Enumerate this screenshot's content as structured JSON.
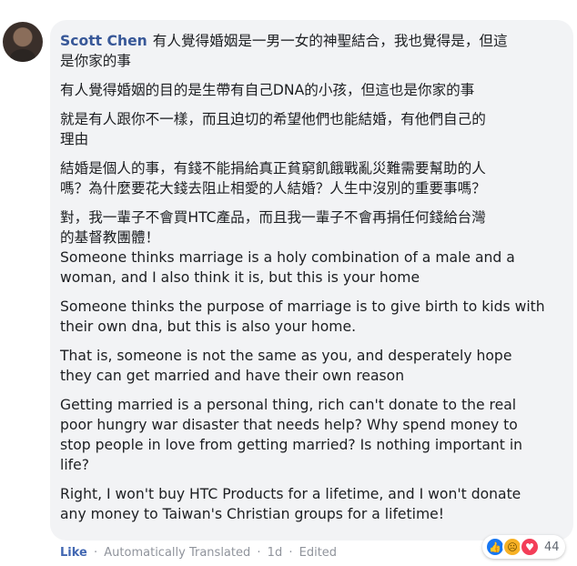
{
  "comment": {
    "author": "Scott Chen",
    "paragraphs_zh": [
      "有人覺得婚姻是一男一女的神聖結合，我也覺得是，但這\n是你家的事",
      "有人覺得婚姻的目的是生帶有自己DNA的小孩，但這也是你家的事",
      "就是有人跟你不一樣，而且迫切的希望他們也能結婚，有他們自己的\n理由",
      "結婚是個人的事，有錢不能捐給真正貧窮飢餓戰亂災難需要幫助的人\n嗎？為什麼要花大錢去阻止相愛的人結婚？人生中沒別的重要事嗎？",
      "對，我一輩子不會買HTC產品，而且我一輩子不會再捐任何錢給台灣\n的基督教團體！"
    ],
    "paragraphs_en": [
      "Someone thinks marriage is a holy combination of a male and a\nwoman, and I also think it is, but this is your home",
      "Someone thinks the purpose of marriage is to give birth to kids with\ntheir own dna, but this is also your home.",
      "That is, someone is not the same as you, and desperately hope\nthey can get married and have their own reason",
      "Getting married is a personal thing, rich can't donate to the real\npoor hungry war disaster that needs help? Why spend money to\nstop people in love from getting married? Is nothing important in\nlife?",
      "Right, I won't buy HTC Products for a lifetime, and I won't donate\nany money to Taiwan's Christian groups for a lifetime!"
    ]
  },
  "actions": {
    "like_label": "Like",
    "separator": "·",
    "translated_label": "Automatically Translated",
    "time": "1d",
    "edited_label": "Edited"
  },
  "reactions": {
    "icons": [
      "like-icon",
      "sad-icon",
      "love-icon"
    ],
    "count": "44"
  }
}
